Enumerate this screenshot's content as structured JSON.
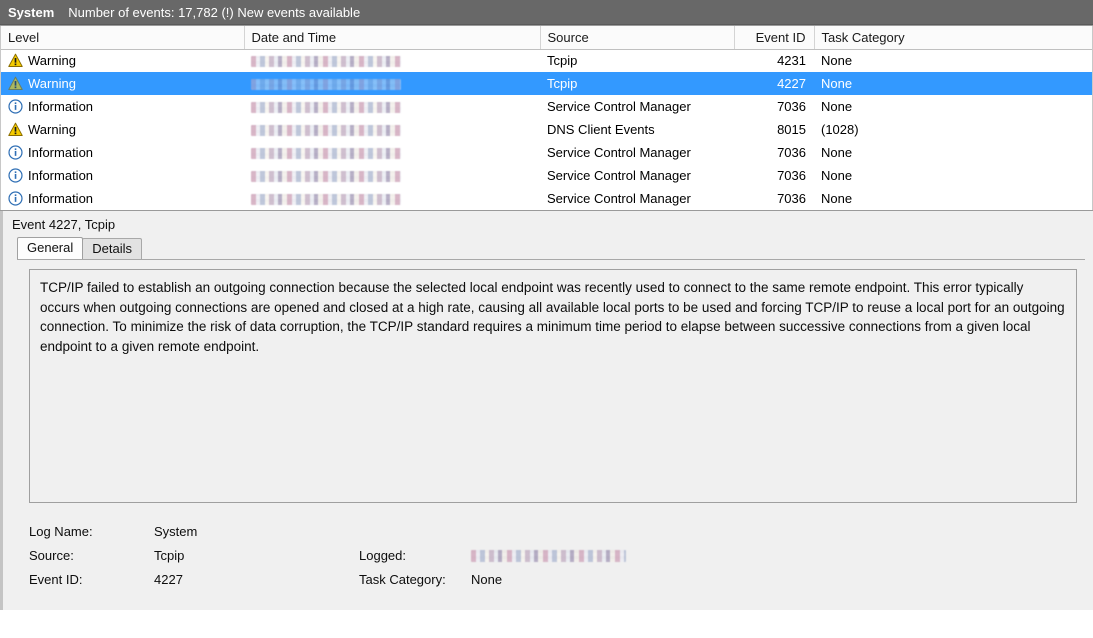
{
  "header": {
    "log_name": "System",
    "events_info": "Number of events: 17,782 (!) New events available",
    "bar_color": "#686868"
  },
  "grid": {
    "columns": [
      {
        "key": "level",
        "label": "Level",
        "align": "left"
      },
      {
        "key": "datetime",
        "label": "Date and Time",
        "align": "left"
      },
      {
        "key": "source",
        "label": "Source",
        "align": "left"
      },
      {
        "key": "event_id",
        "label": "Event ID",
        "align": "right"
      },
      {
        "key": "task_category",
        "label": "Task Category",
        "align": "left"
      }
    ],
    "selection_color": "#3399ff",
    "rows": [
      {
        "level": "Warning",
        "icon": "warning-icon",
        "datetime": "",
        "datetime_redacted": true,
        "source": "Tcpip",
        "event_id": "4231",
        "task_category": "None",
        "selected": false
      },
      {
        "level": "Warning",
        "icon": "warning-icon",
        "datetime": "",
        "datetime_redacted": true,
        "source": "Tcpip",
        "event_id": "4227",
        "task_category": "None",
        "selected": true
      },
      {
        "level": "Information",
        "icon": "information-icon",
        "datetime": "",
        "datetime_redacted": true,
        "source": "Service Control Manager",
        "event_id": "7036",
        "task_category": "None",
        "selected": false
      },
      {
        "level": "Warning",
        "icon": "warning-icon",
        "datetime": "",
        "datetime_redacted": true,
        "source": "DNS Client Events",
        "event_id": "8015",
        "task_category": "(1028)",
        "selected": false
      },
      {
        "level": "Information",
        "icon": "information-icon",
        "datetime": "",
        "datetime_redacted": true,
        "source": "Service Control Manager",
        "event_id": "7036",
        "task_category": "None",
        "selected": false
      },
      {
        "level": "Information",
        "icon": "information-icon",
        "datetime": "",
        "datetime_redacted": true,
        "source": "Service Control Manager",
        "event_id": "7036",
        "task_category": "None",
        "selected": false
      },
      {
        "level": "Information",
        "icon": "information-icon",
        "datetime": "",
        "datetime_redacted": true,
        "source": "Service Control Manager",
        "event_id": "7036",
        "task_category": "None",
        "selected": false
      }
    ]
  },
  "detail": {
    "title": "Event 4227, Tcpip",
    "tabs": [
      {
        "label": "General",
        "active": true
      },
      {
        "label": "Details",
        "active": false
      }
    ],
    "description": "TCP/IP failed to establish an outgoing connection because the selected local endpoint was recently used to connect to the same remote endpoint. This error typically occurs when outgoing connections are opened and closed at a high rate, causing all available local ports to be used and forcing TCP/IP to reuse a local port for an outgoing connection. To minimize the risk of data corruption, the TCP/IP standard requires a minimum time period to elapse between successive connections from a given local endpoint to a given remote endpoint.",
    "fields": {
      "log_name_label": "Log Name:",
      "log_name_value": "System",
      "source_label": "Source:",
      "source_value": "Tcpip",
      "event_id_label": "Event ID:",
      "event_id_value": "4227",
      "logged_label": "Logged:",
      "logged_value": "",
      "logged_redacted": true,
      "task_category_label": "Task Category:",
      "task_category_value": "None"
    }
  }
}
